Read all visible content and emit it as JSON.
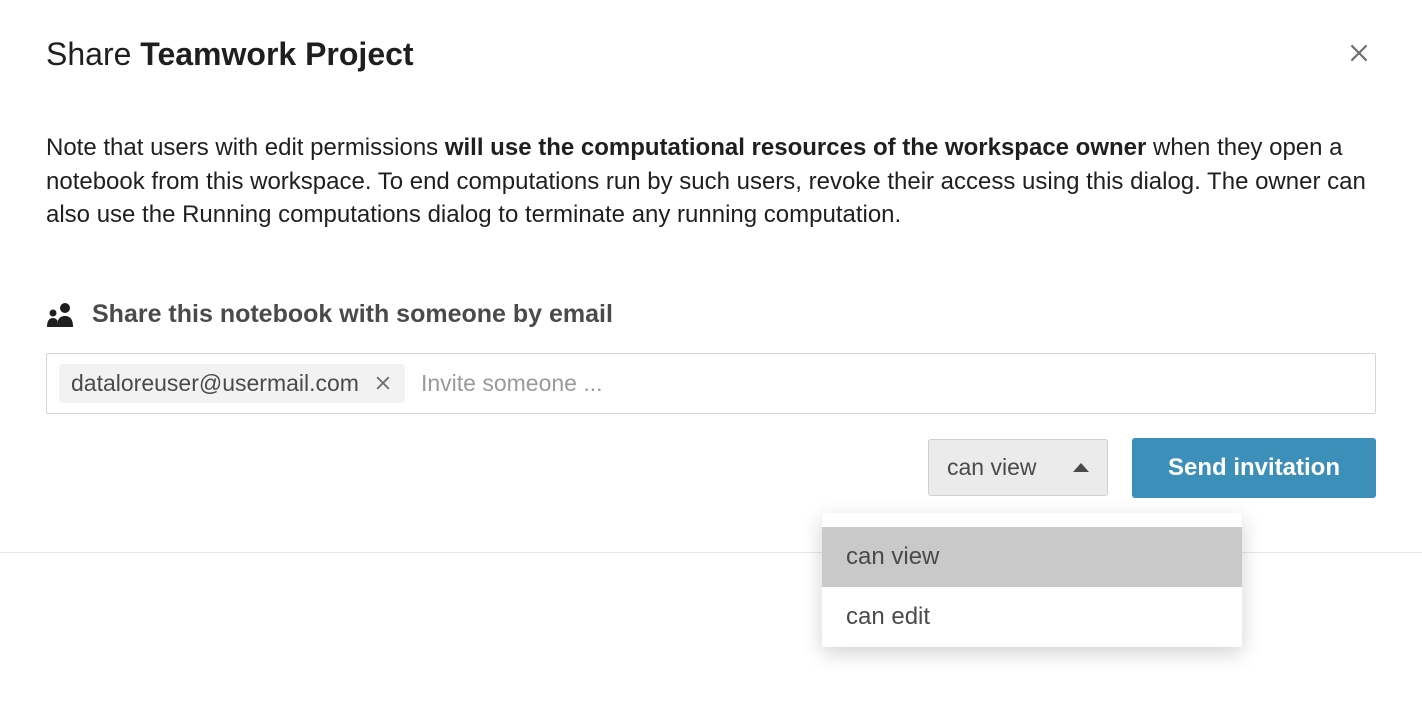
{
  "header": {
    "title_prefix": "Share ",
    "title_bold": "Teamwork Project"
  },
  "description": {
    "part1": "Note that users with edit permissions ",
    "bold": "will use the computational resources of the workspace owner",
    "part2": " when they open a notebook from this workspace. To end computations run by such users, revoke their access using this dialog. The owner can also use the Running computations dialog to terminate any running computation."
  },
  "share_section": {
    "label": "Share this notebook with someone by email",
    "chip_email": "dataloreuser@usermail.com",
    "input_placeholder": "Invite someone ..."
  },
  "actions": {
    "permission_selected": "can view",
    "send_label": "Send invitation"
  },
  "dropdown": {
    "options": [
      {
        "label": "can view",
        "selected": true
      },
      {
        "label": "can edit",
        "selected": false
      }
    ]
  }
}
